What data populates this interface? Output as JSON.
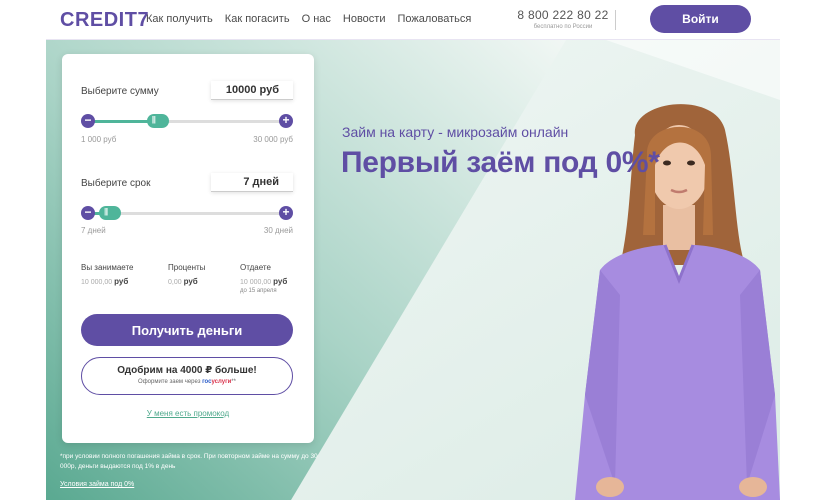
{
  "header": {
    "logo": "CREDIT7",
    "nav": [
      "Как получить",
      "Как погасить",
      "О нас",
      "Новости",
      "Пожаловаться"
    ],
    "phone": "8 800 222 80 22",
    "phone_sub": "бесплатно по России",
    "login_label": "Войти"
  },
  "calculator": {
    "amount": {
      "label": "Выберите сумму",
      "value": "10000 руб",
      "min_label": "1 000 руб",
      "max_label": "30 000 руб",
      "position": 0.31
    },
    "term": {
      "label": "Выберите срок",
      "value": "7 дней",
      "min_label": "7 дней",
      "max_label": "30 дней",
      "position": 0.0
    },
    "summary": {
      "borrow": {
        "head": "Вы занимаете",
        "amount": "10 000,00",
        "currency": "руб"
      },
      "interest": {
        "head": "Проценты",
        "amount": "0,00",
        "currency": "руб"
      },
      "return": {
        "head": "Отдаете",
        "amount": "10 000,00",
        "currency": "руб",
        "note": "до 15 апреля"
      }
    },
    "get_money_label": "Получить деньги",
    "approve": {
      "main": "Одобрим на 4000 ₽ больше!",
      "sub_prefix": "Оформите заем через",
      "gos_part1": "гос",
      "gos_part2": "услуги",
      "sub_suffix": "**"
    },
    "promo_label": "У меня есть промокод"
  },
  "hero": {
    "subtitle": "Займ на карту - микрозайм онлайн",
    "title": "Первый заём под 0%*"
  },
  "footnote": {
    "text": "*при условии полного погашения займа в срок. При повторном займе на сумму до 30 000р, деньги выдаются под 1% в день",
    "link": "Условия займа под 0%"
  },
  "colors": {
    "brand_purple": "#5f4ea4",
    "accent_green": "#4fb59a",
    "hero_bg_dark": "#68b8a2",
    "hero_bg_light": "#eef5f2"
  }
}
